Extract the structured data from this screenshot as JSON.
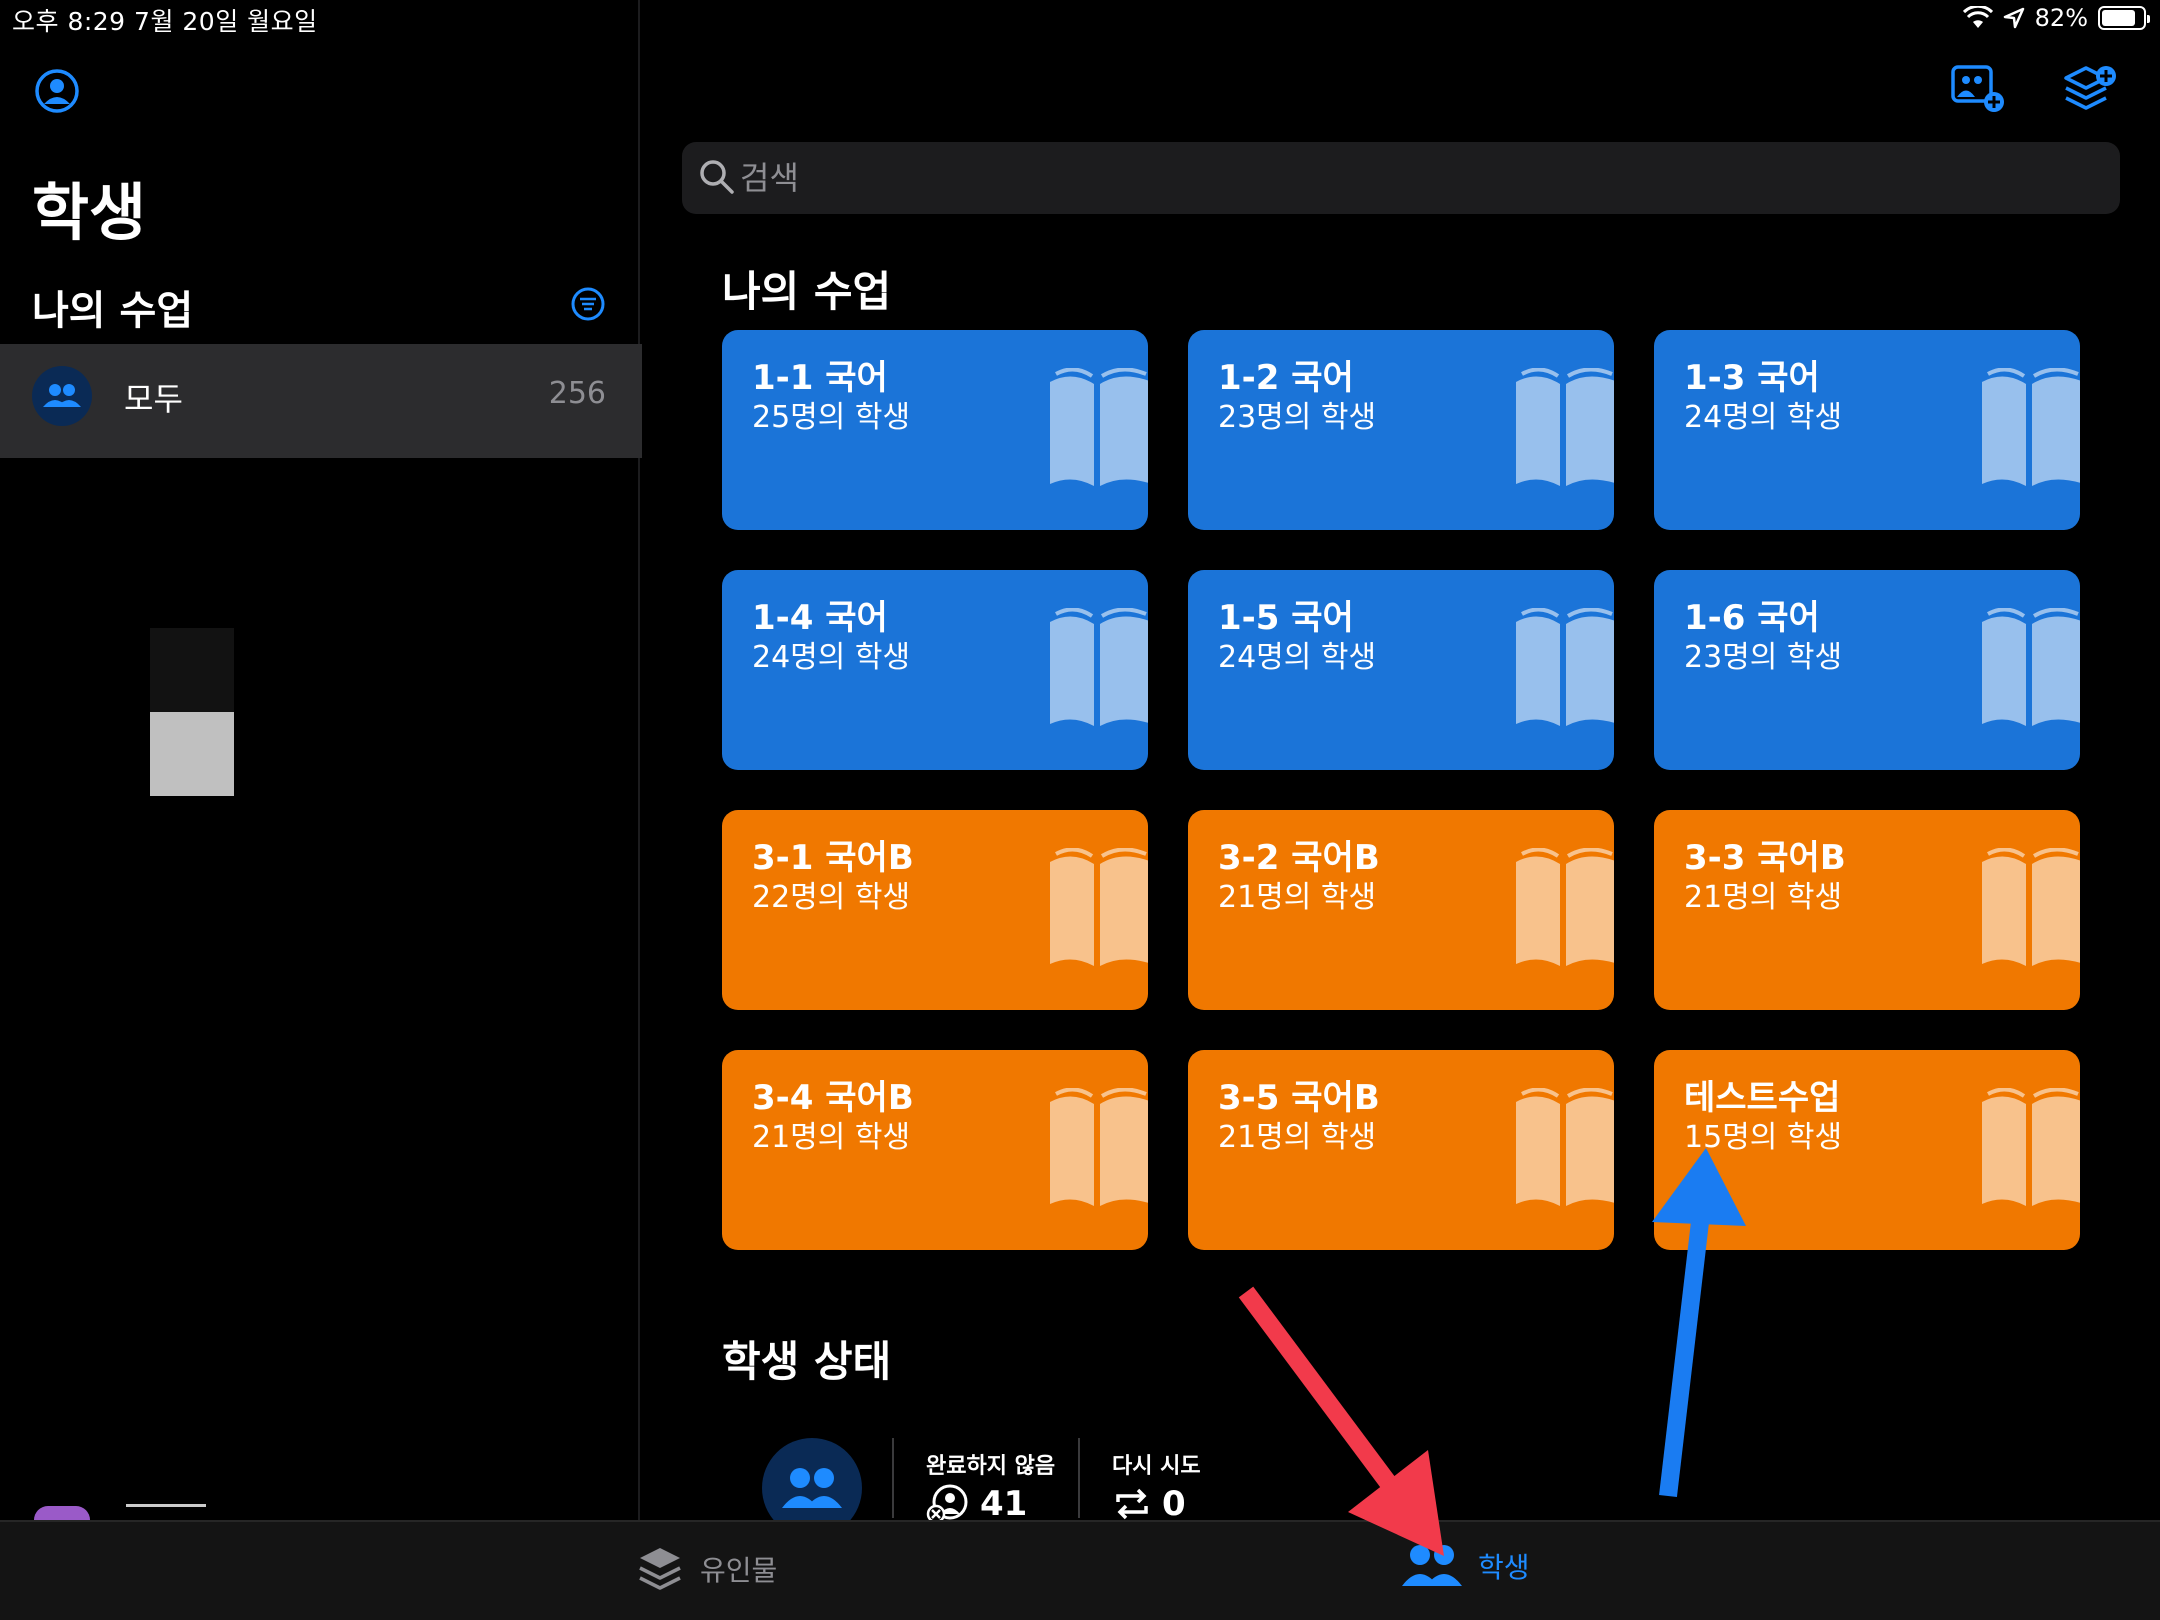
{
  "status_bar": {
    "time": "오후 8:29   7월 20일 월요일",
    "battery": "82%",
    "battery_level": 0.82
  },
  "sidebar": {
    "title": "학생",
    "section": "나의 수업",
    "rows": [
      {
        "label": "모두",
        "count": "256"
      }
    ]
  },
  "search": {
    "placeholder": "검색"
  },
  "main": {
    "classes_title": "나의 수업",
    "status_title": "학생 상태",
    "classes": [
      {
        "name": "1-1 국어",
        "students": "25명의 학생",
        "color": "#1b74d8"
      },
      {
        "name": "1-2 국어",
        "students": "23명의 학생",
        "color": "#1b74d8"
      },
      {
        "name": "1-3 국어",
        "students": "24명의 학생",
        "color": "#1b74d8"
      },
      {
        "name": "1-4 국어",
        "students": "24명의 학생",
        "color": "#1b74d8"
      },
      {
        "name": "1-5 국어",
        "students": "24명의 학생",
        "color": "#1b74d8"
      },
      {
        "name": "1-6 국어",
        "students": "23명의 학생",
        "color": "#1b74d8"
      },
      {
        "name": "3-1 국어B",
        "students": "22명의 학생",
        "color": "#f07800"
      },
      {
        "name": "3-2 국어B",
        "students": "21명의 학생",
        "color": "#f07800"
      },
      {
        "name": "3-3 국어B",
        "students": "21명의 학생",
        "color": "#f07800"
      },
      {
        "name": "3-4 국어B",
        "students": "21명의 학생",
        "color": "#f07800"
      },
      {
        "name": "3-5 국어B",
        "students": "21명의 학생",
        "color": "#f07800"
      },
      {
        "name": "테스트수업",
        "students": "15명의 학생",
        "color": "#f07800"
      }
    ],
    "status": {
      "incomplete_label": "완료하지 않음",
      "incomplete_value": "41",
      "retry_label": "다시 시도",
      "retry_value": "0"
    }
  },
  "tabbar": {
    "handouts": "유인물",
    "students": "학생"
  },
  "colors": {
    "accent": "#1e8bff",
    "blue_card": "#1b74d8",
    "orange_card": "#f07800",
    "red_arrow": "#f23a4b",
    "blue_arrow": "#1a7cf2"
  }
}
